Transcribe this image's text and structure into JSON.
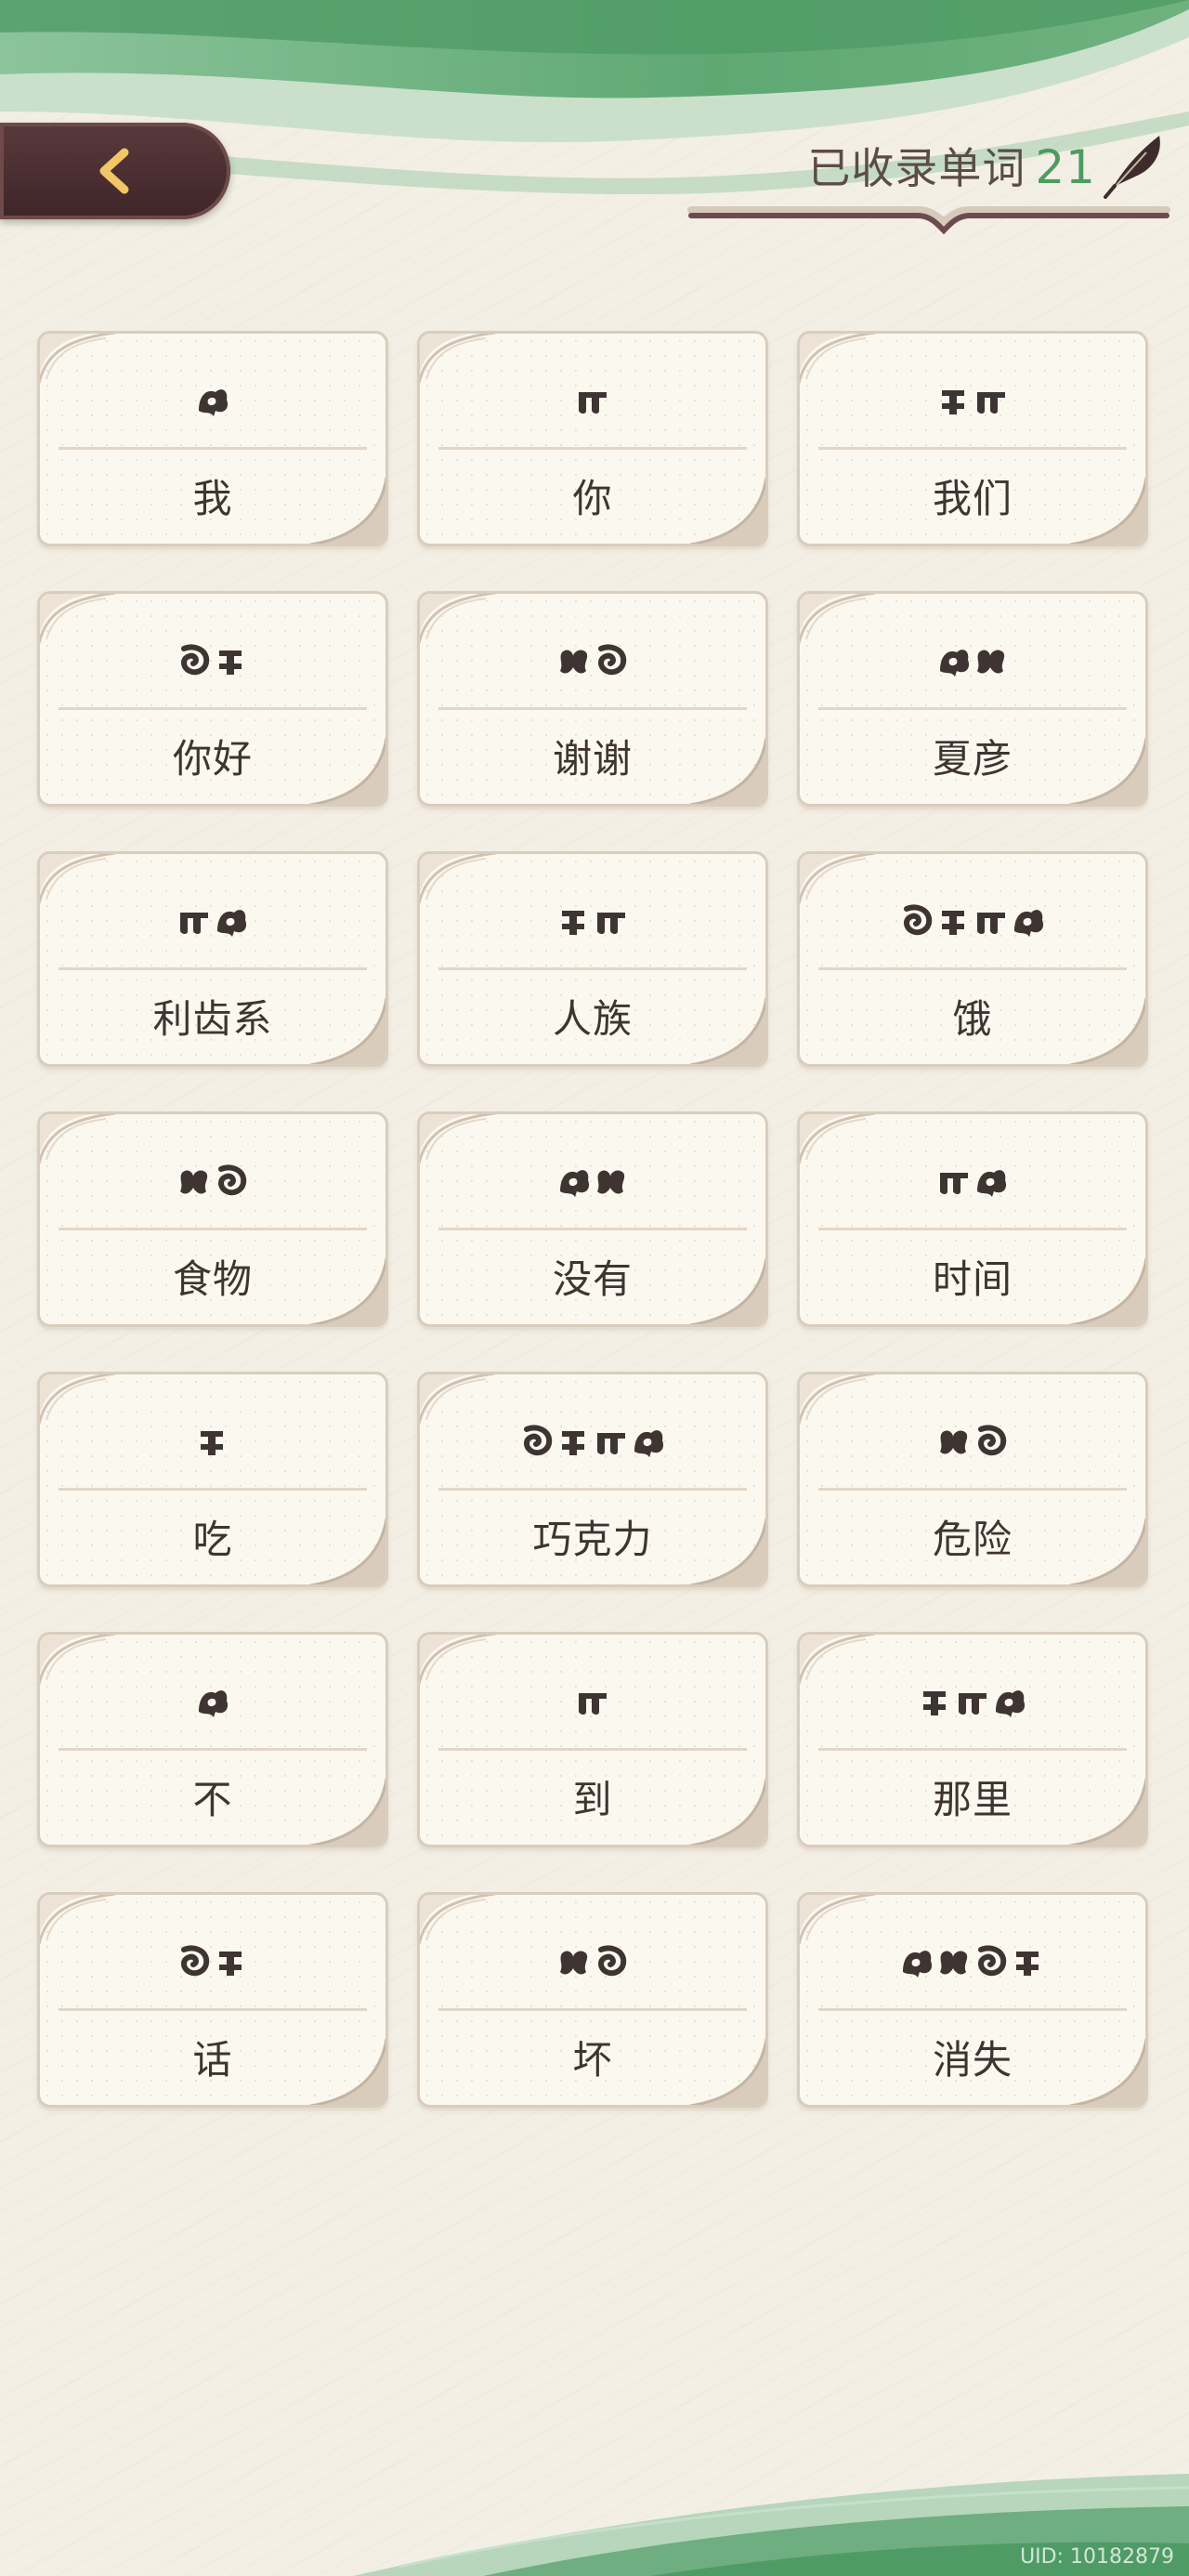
{
  "header": {
    "counter_label": "已收录单词",
    "counter_value": "21"
  },
  "words": [
    {
      "glyph_count": 1,
      "meaning": "我"
    },
    {
      "glyph_count": 1,
      "meaning": "你"
    },
    {
      "glyph_count": 2,
      "meaning": "我们"
    },
    {
      "glyph_count": 2,
      "meaning": "你好"
    },
    {
      "glyph_count": 2,
      "meaning": "谢谢"
    },
    {
      "glyph_count": 2,
      "meaning": "夏彦"
    },
    {
      "glyph_count": 2,
      "meaning": "利齿系"
    },
    {
      "glyph_count": 2,
      "meaning": "人族"
    },
    {
      "glyph_count": 4,
      "meaning": "饿"
    },
    {
      "glyph_count": 2,
      "meaning": "食物"
    },
    {
      "glyph_count": 2,
      "meaning": "没有"
    },
    {
      "glyph_count": 2,
      "meaning": "时间"
    },
    {
      "glyph_count": 1,
      "meaning": "吃"
    },
    {
      "glyph_count": 4,
      "meaning": "巧克力"
    },
    {
      "glyph_count": 2,
      "meaning": "危险"
    },
    {
      "glyph_count": 1,
      "meaning": "不"
    },
    {
      "glyph_count": 1,
      "meaning": "到"
    },
    {
      "glyph_count": 3,
      "meaning": "那里"
    },
    {
      "glyph_count": 2,
      "meaning": "话"
    },
    {
      "glyph_count": 2,
      "meaning": "坏"
    },
    {
      "glyph_count": 4,
      "meaning": "消失"
    }
  ],
  "footer": {
    "uid": "UID: 10182879"
  },
  "colors": {
    "accent_green": "#4e9b62",
    "card_bg": "#fbf8ef",
    "back_button": "#4a2e31"
  },
  "icons": {
    "back": "chevron-left-icon",
    "quill": "quill-icon"
  }
}
